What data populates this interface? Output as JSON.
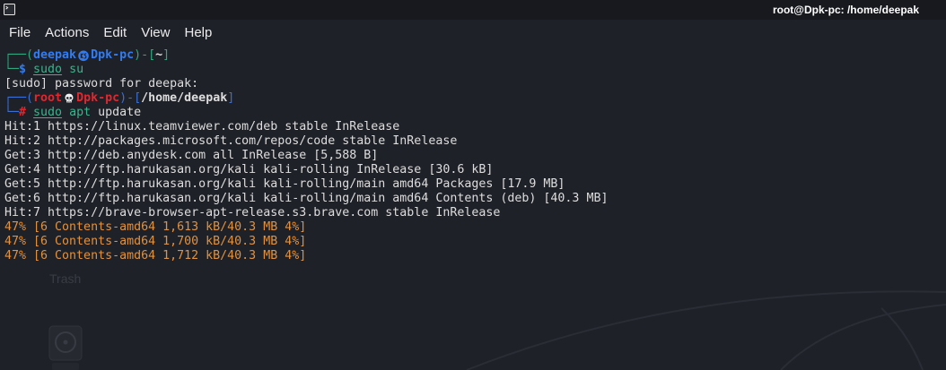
{
  "window": {
    "title": "root@Dpk-pc: /home/deepak",
    "icon": "terminal-icon"
  },
  "menu": {
    "items": [
      "File",
      "Actions",
      "Edit",
      "View",
      "Help"
    ]
  },
  "terminal": {
    "prompt_user": {
      "corner_top": "┌──(",
      "username": "deepak",
      "separator_icon": "korean-mark-icon",
      "hostname": "Dpk-pc",
      "path_open": ")-[",
      "cwd": "~",
      "path_close": "]",
      "corner_bottom": "└─",
      "symbol": "$",
      "command": [
        "sudo",
        "su"
      ]
    },
    "password_prompt": "[sudo] password for deepak:",
    "prompt_root": {
      "corner_top": "┌──(",
      "username": "root",
      "separator_icon": "skull-icon",
      "hostname": "Dpk-pc",
      "path_open": ")-[",
      "cwd": "/home/deepak",
      "path_close": "]",
      "corner_bottom": "└─",
      "symbol": "#",
      "command": [
        "sudo",
        "apt",
        "update"
      ]
    },
    "output_lines": [
      "Hit:1 https://linux.teamviewer.com/deb stable InRelease",
      "Hit:2 http://packages.microsoft.com/repos/code stable InRelease",
      "Get:3 http://deb.anydesk.com all InRelease [5,588 B]",
      "Get:4 http://ftp.harukasan.org/kali kali-rolling InRelease [30.6 kB]",
      "Get:5 http://ftp.harukasan.org/kali kali-rolling/main amd64 Packages [17.9 MB]",
      "Get:6 http://ftp.harukasan.org/kali kali-rolling/main amd64 Contents (deb) [40.3 MB]",
      "Hit:7 https://brave-browser-apt-release.s3.brave.com stable InRelease"
    ],
    "progress_lines": [
      "47% [6 Contents-amd64 1,613 kB/40.3 MB 4%]",
      "47% [6 Contents-amd64 1,700 kB/40.3 MB 4%]",
      "47% [6 Contents-amd64 1,712 kB/40.3 MB 4%]"
    ]
  },
  "desktop": {
    "trash_label": "Trash",
    "icons": [
      "drive-icon"
    ]
  },
  "colors": {
    "titlebar_bg": "#18191e",
    "terminal_bg": "#1f2128",
    "foreground": "#dddddd",
    "title_text": "#ffffff",
    "menu_text": "#ececec",
    "prompt_green": "#2fa87f",
    "prompt_blue": "#2f7cf5",
    "prompt_box_blue": "#3a6fd6",
    "prompt_red": "#e2262e",
    "command_green": "#3ab48c",
    "progress_orange": "#e2913d",
    "desktop_faint": "#393c44"
  }
}
